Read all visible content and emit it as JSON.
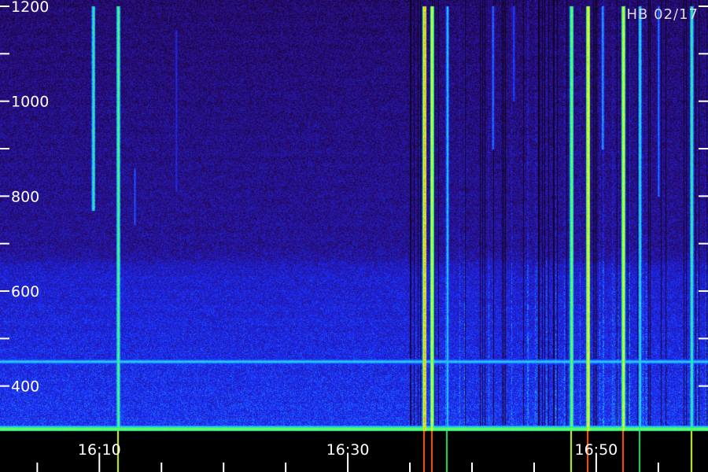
{
  "title": "HB 02/17",
  "chart_data": {
    "type": "heatmap",
    "title": "HB 02/17",
    "xlabel": "",
    "ylabel": "",
    "ylim": [
      305,
      1200
    ],
    "xlim": [
      "16:02",
      "16:59"
    ],
    "y_ticks": [
      400,
      500,
      600,
      700,
      800,
      900,
      1000,
      1100,
      1200
    ],
    "y_tick_labels": [
      "400",
      "600",
      "800",
      "1000",
      "1200"
    ],
    "x_tick_labels": [
      "16:10",
      "16:30",
      "16:50"
    ],
    "x_major_ticks": [
      "16:10",
      "16:30",
      "16:50"
    ],
    "x_minor_ticks": [
      "16:05",
      "16:15",
      "16:20",
      "16:25",
      "16:35",
      "16:40",
      "16:45",
      "16:55"
    ],
    "colormap": [
      "#000000",
      "#2a0a6b",
      "#1a2cff",
      "#22c8ff",
      "#33ff66",
      "#ffff33",
      "#ff3300"
    ],
    "background_level": "dark purple above 700, blue below 640",
    "bands": [
      {
        "y": 452,
        "strength": 0.55
      },
      {
        "y": 310,
        "strength": 0.75
      }
    ],
    "bursts": [
      {
        "x": "16:09:30",
        "y_range": [
          770,
          1200
        ],
        "strength": 0.65
      },
      {
        "x": "16:11:30",
        "y_range": [
          305,
          1200
        ],
        "strength": 0.7
      },
      {
        "x": "16:12:50",
        "y_range": [
          740,
          860
        ],
        "strength": 0.4
      },
      {
        "x": "16:16:10",
        "y_range": [
          810,
          1150
        ],
        "strength": 0.35
      },
      {
        "x": "16:36:10",
        "y_range": [
          305,
          1200
        ],
        "strength": 0.95
      },
      {
        "x": "16:36:45",
        "y_range": [
          305,
          1200
        ],
        "strength": 0.85
      },
      {
        "x": "16:38:00",
        "y_range": [
          305,
          1200
        ],
        "strength": 0.55
      },
      {
        "x": "16:41:40",
        "y_range": [
          900,
          1200
        ],
        "strength": 0.45
      },
      {
        "x": "16:43:20",
        "y_range": [
          1000,
          1200
        ],
        "strength": 0.4
      },
      {
        "x": "16:48:00",
        "y_range": [
          305,
          1200
        ],
        "strength": 0.75
      },
      {
        "x": "16:49:20",
        "y_range": [
          305,
          1200
        ],
        "strength": 0.9
      },
      {
        "x": "16:50:30",
        "y_range": [
          900,
          1200
        ],
        "strength": 0.5
      },
      {
        "x": "16:52:10",
        "y_range": [
          305,
          1200
        ],
        "strength": 0.85
      },
      {
        "x": "16:53:30",
        "y_range": [
          305,
          1200
        ],
        "strength": 0.6
      },
      {
        "x": "16:55:00",
        "y_range": [
          800,
          1200
        ],
        "strength": 0.45
      },
      {
        "x": "16:57:40",
        "y_range": [
          305,
          1200
        ],
        "strength": 0.65
      }
    ]
  }
}
